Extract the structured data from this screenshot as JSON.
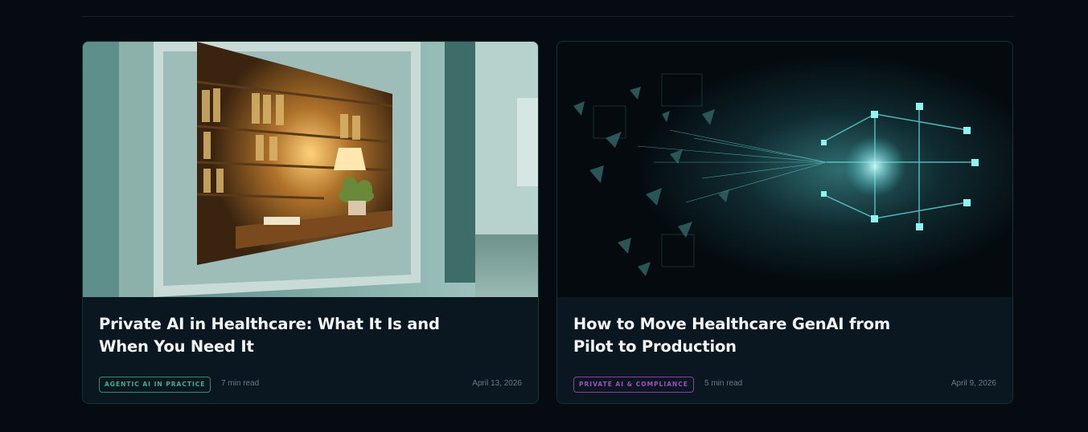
{
  "articles": [
    {
      "title": "Private AI in Healthcare: What It Is and When You Need It",
      "tag": "AGENTIC AI IN PRACTICE",
      "tag_color": "#3fae8c",
      "read_time": "7 min read",
      "date": "April 13, 2026",
      "image": "hospital-records-room-photo"
    },
    {
      "title": "How to Move Healthcare GenAI from Pilot to Production",
      "tag": "PRIVATE AI & COMPLIANCE",
      "tag_color": "#a04fc0",
      "read_time": "5 min read",
      "date": "April 9, 2026",
      "image": "fragments-to-network-illustration"
    }
  ],
  "colors": {
    "background": "#060b11",
    "card": "#0a1620",
    "card_border": "#113531"
  }
}
